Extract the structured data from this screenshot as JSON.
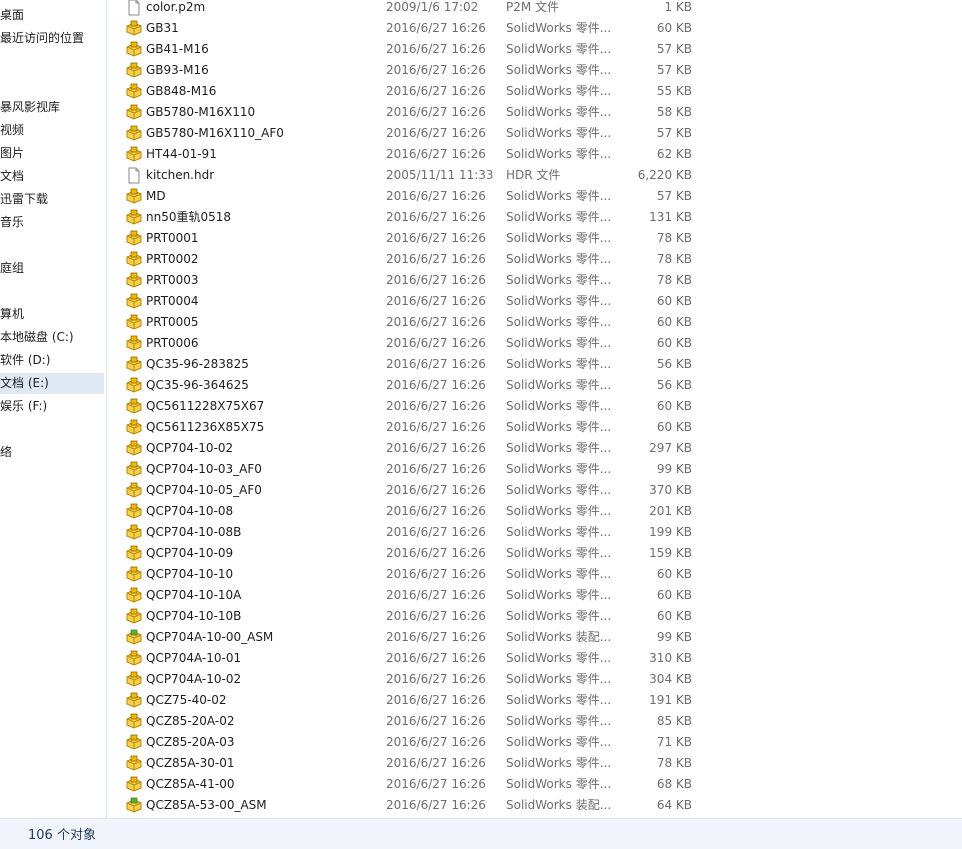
{
  "nav": {
    "items": [
      {
        "label": "桌面",
        "selected": false
      },
      {
        "label": "最近访问的位置",
        "selected": false
      },
      {
        "label": "",
        "selected": false
      },
      {
        "label": "",
        "selected": false
      },
      {
        "label": "暴风影视库",
        "selected": false
      },
      {
        "label": "视频",
        "selected": false
      },
      {
        "label": "图片",
        "selected": false
      },
      {
        "label": "文档",
        "selected": false
      },
      {
        "label": "迅雷下载",
        "selected": false
      },
      {
        "label": "音乐",
        "selected": false
      },
      {
        "label": "",
        "selected": false
      },
      {
        "label": "庭组",
        "selected": false
      },
      {
        "label": "",
        "selected": false
      },
      {
        "label": "算机",
        "selected": false
      },
      {
        "label": "本地磁盘 (C:)",
        "selected": false
      },
      {
        "label": "软件 (D:)",
        "selected": false
      },
      {
        "label": "文档 (E:)",
        "selected": true
      },
      {
        "label": "娱乐 (F:)",
        "selected": false
      },
      {
        "label": "",
        "selected": false
      },
      {
        "label": "络",
        "selected": false
      }
    ]
  },
  "files": [
    {
      "name": "color.p2m",
      "date": "2009/1/6 17:02",
      "type": "P2M 文件",
      "size": "1 KB",
      "icon": "generic-file"
    },
    {
      "name": "GB31",
      "date": "2016/6/27 16:26",
      "type": "SolidWorks 零件...",
      "size": "60 KB",
      "icon": "solidworks-part"
    },
    {
      "name": "GB41-M16",
      "date": "2016/6/27 16:26",
      "type": "SolidWorks 零件...",
      "size": "57 KB",
      "icon": "solidworks-part"
    },
    {
      "name": "GB93-M16",
      "date": "2016/6/27 16:26",
      "type": "SolidWorks 零件...",
      "size": "57 KB",
      "icon": "solidworks-part"
    },
    {
      "name": "GB848-M16",
      "date": "2016/6/27 16:26",
      "type": "SolidWorks 零件...",
      "size": "55 KB",
      "icon": "solidworks-part"
    },
    {
      "name": "GB5780-M16X110",
      "date": "2016/6/27 16:26",
      "type": "SolidWorks 零件...",
      "size": "58 KB",
      "icon": "solidworks-part"
    },
    {
      "name": "GB5780-M16X110_AF0",
      "date": "2016/6/27 16:26",
      "type": "SolidWorks 零件...",
      "size": "57 KB",
      "icon": "solidworks-part"
    },
    {
      "name": "HT44-01-91",
      "date": "2016/6/27 16:26",
      "type": "SolidWorks 零件...",
      "size": "62 KB",
      "icon": "solidworks-part"
    },
    {
      "name": "kitchen.hdr",
      "date": "2005/11/11 11:33",
      "type": "HDR 文件",
      "size": "6,220 KB",
      "icon": "generic-file"
    },
    {
      "name": "MD",
      "date": "2016/6/27 16:26",
      "type": "SolidWorks 零件...",
      "size": "57 KB",
      "icon": "solidworks-part"
    },
    {
      "name": "nn50重轨0518",
      "date": "2016/6/27 16:26",
      "type": "SolidWorks 零件...",
      "size": "131 KB",
      "icon": "solidworks-part"
    },
    {
      "name": "PRT0001",
      "date": "2016/6/27 16:26",
      "type": "SolidWorks 零件...",
      "size": "78 KB",
      "icon": "solidworks-part"
    },
    {
      "name": "PRT0002",
      "date": "2016/6/27 16:26",
      "type": "SolidWorks 零件...",
      "size": "78 KB",
      "icon": "solidworks-part"
    },
    {
      "name": "PRT0003",
      "date": "2016/6/27 16:26",
      "type": "SolidWorks 零件...",
      "size": "78 KB",
      "icon": "solidworks-part"
    },
    {
      "name": "PRT0004",
      "date": "2016/6/27 16:26",
      "type": "SolidWorks 零件...",
      "size": "60 KB",
      "icon": "solidworks-part"
    },
    {
      "name": "PRT0005",
      "date": "2016/6/27 16:26",
      "type": "SolidWorks 零件...",
      "size": "60 KB",
      "icon": "solidworks-part"
    },
    {
      "name": "PRT0006",
      "date": "2016/6/27 16:26",
      "type": "SolidWorks 零件...",
      "size": "60 KB",
      "icon": "solidworks-part"
    },
    {
      "name": "QC35-96-283825",
      "date": "2016/6/27 16:26",
      "type": "SolidWorks 零件...",
      "size": "56 KB",
      "icon": "solidworks-part"
    },
    {
      "name": "QC35-96-364625",
      "date": "2016/6/27 16:26",
      "type": "SolidWorks 零件...",
      "size": "56 KB",
      "icon": "solidworks-part"
    },
    {
      "name": "QC5611228X75X67",
      "date": "2016/6/27 16:26",
      "type": "SolidWorks 零件...",
      "size": "60 KB",
      "icon": "solidworks-part"
    },
    {
      "name": "QC5611236X85X75",
      "date": "2016/6/27 16:26",
      "type": "SolidWorks 零件...",
      "size": "60 KB",
      "icon": "solidworks-part"
    },
    {
      "name": "QCP704-10-02",
      "date": "2016/6/27 16:26",
      "type": "SolidWorks 零件...",
      "size": "297 KB",
      "icon": "solidworks-part"
    },
    {
      "name": "QCP704-10-03_AF0",
      "date": "2016/6/27 16:26",
      "type": "SolidWorks 零件...",
      "size": "99 KB",
      "icon": "solidworks-part"
    },
    {
      "name": "QCP704-10-05_AF0",
      "date": "2016/6/27 16:26",
      "type": "SolidWorks 零件...",
      "size": "370 KB",
      "icon": "solidworks-part"
    },
    {
      "name": "QCP704-10-08",
      "date": "2016/6/27 16:26",
      "type": "SolidWorks 零件...",
      "size": "201 KB",
      "icon": "solidworks-part"
    },
    {
      "name": "QCP704-10-08B",
      "date": "2016/6/27 16:26",
      "type": "SolidWorks 零件...",
      "size": "199 KB",
      "icon": "solidworks-part"
    },
    {
      "name": "QCP704-10-09",
      "date": "2016/6/27 16:26",
      "type": "SolidWorks 零件...",
      "size": "159 KB",
      "icon": "solidworks-part"
    },
    {
      "name": "QCP704-10-10",
      "date": "2016/6/27 16:26",
      "type": "SolidWorks 零件...",
      "size": "60 KB",
      "icon": "solidworks-part"
    },
    {
      "name": "QCP704-10-10A",
      "date": "2016/6/27 16:26",
      "type": "SolidWorks 零件...",
      "size": "60 KB",
      "icon": "solidworks-part"
    },
    {
      "name": "QCP704-10-10B",
      "date": "2016/6/27 16:26",
      "type": "SolidWorks 零件...",
      "size": "60 KB",
      "icon": "solidworks-part"
    },
    {
      "name": "QCP704A-10-00_ASM",
      "date": "2016/6/27 16:26",
      "type": "SolidWorks 装配...",
      "size": "99 KB",
      "icon": "solidworks-assembly"
    },
    {
      "name": "QCP704A-10-01",
      "date": "2016/6/27 16:26",
      "type": "SolidWorks 零件...",
      "size": "310 KB",
      "icon": "solidworks-part"
    },
    {
      "name": "QCP704A-10-02",
      "date": "2016/6/27 16:26",
      "type": "SolidWorks 零件...",
      "size": "304 KB",
      "icon": "solidworks-part"
    },
    {
      "name": "QCZ75-40-02",
      "date": "2016/6/27 16:26",
      "type": "SolidWorks 零件...",
      "size": "191 KB",
      "icon": "solidworks-part"
    },
    {
      "name": "QCZ85-20A-02",
      "date": "2016/6/27 16:26",
      "type": "SolidWorks 零件...",
      "size": "85 KB",
      "icon": "solidworks-part"
    },
    {
      "name": "QCZ85-20A-03",
      "date": "2016/6/27 16:26",
      "type": "SolidWorks 零件...",
      "size": "71 KB",
      "icon": "solidworks-part"
    },
    {
      "name": "QCZ85A-30-01",
      "date": "2016/6/27 16:26",
      "type": "SolidWorks 零件...",
      "size": "78 KB",
      "icon": "solidworks-part"
    },
    {
      "name": "QCZ85A-41-00",
      "date": "2016/6/27 16:26",
      "type": "SolidWorks 零件...",
      "size": "68 KB",
      "icon": "solidworks-part"
    },
    {
      "name": "QCZ85A-53-00_ASM",
      "date": "2016/6/27 16:26",
      "type": "SolidWorks 装配...",
      "size": "64 KB",
      "icon": "solidworks-assembly"
    }
  ],
  "status": {
    "count_text": "106 个对象"
  },
  "colors": {
    "selected_bg": "#dfe8f3",
    "status_bg": "#f1f5fb",
    "part_icon": "#f2b705",
    "assembly_icon": "#3cba3c"
  }
}
